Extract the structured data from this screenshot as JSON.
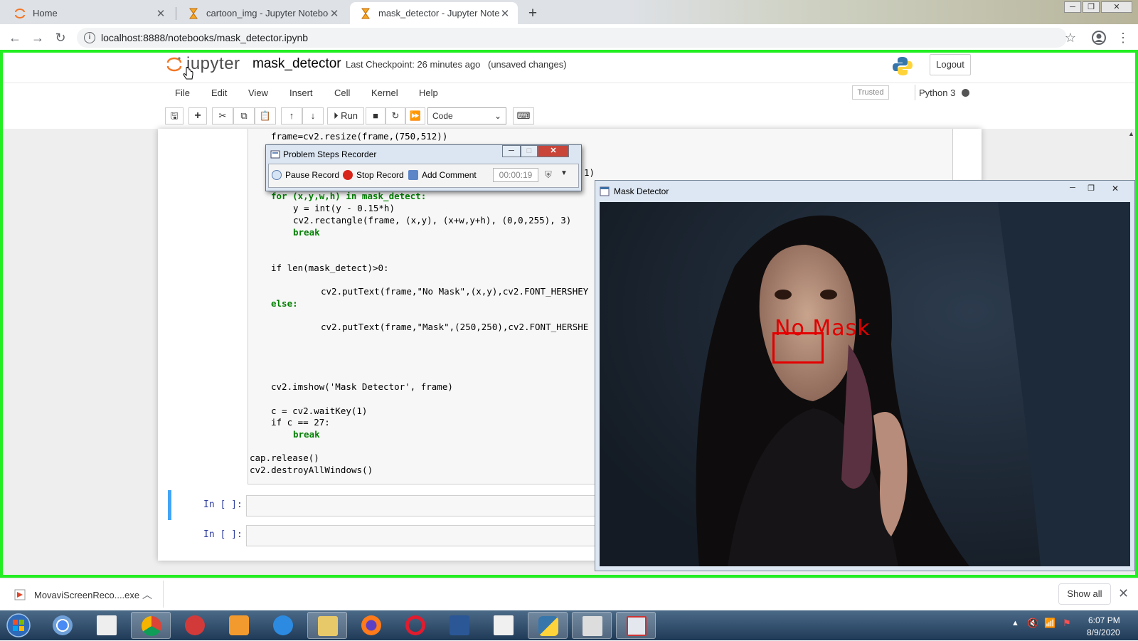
{
  "browser": {
    "tabs": [
      {
        "label": "Home",
        "icon": "jupyter-icon",
        "active": false
      },
      {
        "label": "cartoon_img - Jupyter Notebook",
        "icon": "hourglass-icon",
        "active": false
      },
      {
        "label": "mask_detector - Jupyter Noteboo",
        "icon": "hourglass-icon",
        "active": true
      }
    ],
    "new_tab": "+",
    "url": "localhost:8888/notebooks/mask_detector.ipynb",
    "close_glyph": "✕"
  },
  "jupyter": {
    "logo_text": "jupyter",
    "notebook_name": "mask_detector",
    "checkpoint": "Last Checkpoint: 26 minutes ago",
    "unsaved": "(unsaved changes)",
    "logout": "Logout",
    "menu": [
      "File",
      "Edit",
      "View",
      "Insert",
      "Cell",
      "Kernel",
      "Help"
    ],
    "trusted": "Trusted",
    "kernel": "Python 3",
    "run_label": "Run",
    "cell_type": "Code",
    "prompt_empty": "In [ ]:"
  },
  "code_lines": {
    "l1": "frame=cv2.resize(frame,(750,512))",
    "l_partial": "1)",
    "l3": "for (x,y,w,h) in mask_detect:",
    "l4": "y = int(y - 0.15*h)",
    "l5": "cv2.rectangle(frame, (x,y), (x+w,y+h), (0,0,255), 3)",
    "l6": "break",
    "l7": "if len(mask_detect)>0:",
    "l8": "cv2.putText(frame,\"No Mask\",(x,y),cv2.FONT_HERSHEY",
    "l9": "else:",
    "l10": "cv2.putText(frame,\"Mask\",(250,250),cv2.FONT_HERSHE",
    "l11": "cv2.imshow('Mask Detector', frame)",
    "l12": "c = cv2.waitKey(1)",
    "l13": "if c == 27:",
    "l14": "break",
    "l15": "cap.release()",
    "l16": "cv2.destroyAllWindows()"
  },
  "psr": {
    "title": "Problem Steps Recorder",
    "pause": "Pause Record",
    "stop": "Stop Record",
    "comment": "Add Comment",
    "timer": "00:00:19"
  },
  "mask_window": {
    "title": "Mask Detector",
    "overlay_text": "No Mask"
  },
  "downloads": {
    "file": "MovaviScreenReco....exe",
    "show_all": "Show all"
  },
  "taskbar": {
    "time": "6:07 PM",
    "date": "8/9/2020"
  },
  "colors": {
    "frame_green": "#22ee22",
    "jupyter_orange": "#f37726",
    "overlay_red": "#e00000"
  }
}
